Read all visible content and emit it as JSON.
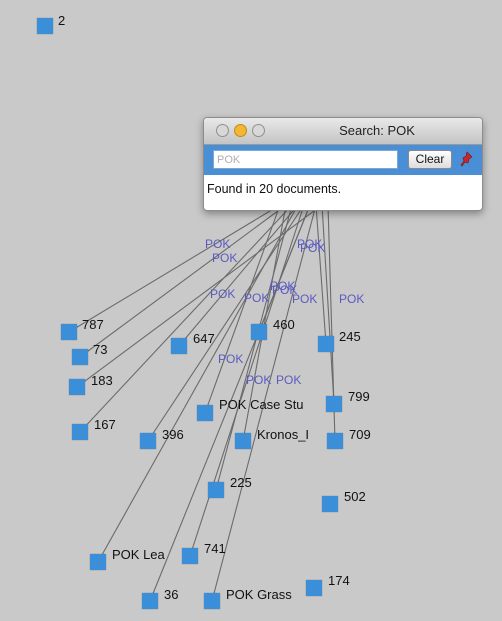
{
  "search_window": {
    "title": "Search: POK",
    "input_placeholder": "POK",
    "clear_label": "Clear",
    "status": "Found in 20 documents.",
    "pin_icon": "pin-icon"
  },
  "nodes": [
    {
      "id": "2",
      "label": "2"
    },
    {
      "id": "787",
      "label": "787"
    },
    {
      "id": "73",
      "label": "73"
    },
    {
      "id": "183",
      "label": "183"
    },
    {
      "id": "167",
      "label": "167"
    },
    {
      "id": "647",
      "label": "647"
    },
    {
      "id": "396",
      "label": "396"
    },
    {
      "id": "460",
      "label": "460"
    },
    {
      "id": "245",
      "label": "245"
    },
    {
      "id": "799",
      "label": "799"
    },
    {
      "id": "709",
      "label": "709"
    },
    {
      "id": "pok-case-study",
      "label": "POK Case Stu"
    },
    {
      "id": "kronos",
      "label": "Kronos_I"
    },
    {
      "id": "225",
      "label": "225"
    },
    {
      "id": "502",
      "label": "502"
    },
    {
      "id": "pok-leaders",
      "label": "POK Lea"
    },
    {
      "id": "741",
      "label": "741"
    },
    {
      "id": "36",
      "label": "36"
    },
    {
      "id": "pok-grassroots",
      "label": "POK Grass"
    },
    {
      "id": "174",
      "label": "174"
    }
  ],
  "edge_labels": [
    "POK",
    "POK",
    "POK",
    "POK",
    "POK",
    "POK",
    "POK",
    "POK",
    "POK",
    "POK",
    "POK",
    "POK",
    "POK"
  ],
  "colors": {
    "background": "#c9c9c9",
    "node": "#3b8fd9",
    "edge": "#6b6b6b",
    "edge_label": "#5a5ac0",
    "toolbar": "#4a8fd6"
  }
}
